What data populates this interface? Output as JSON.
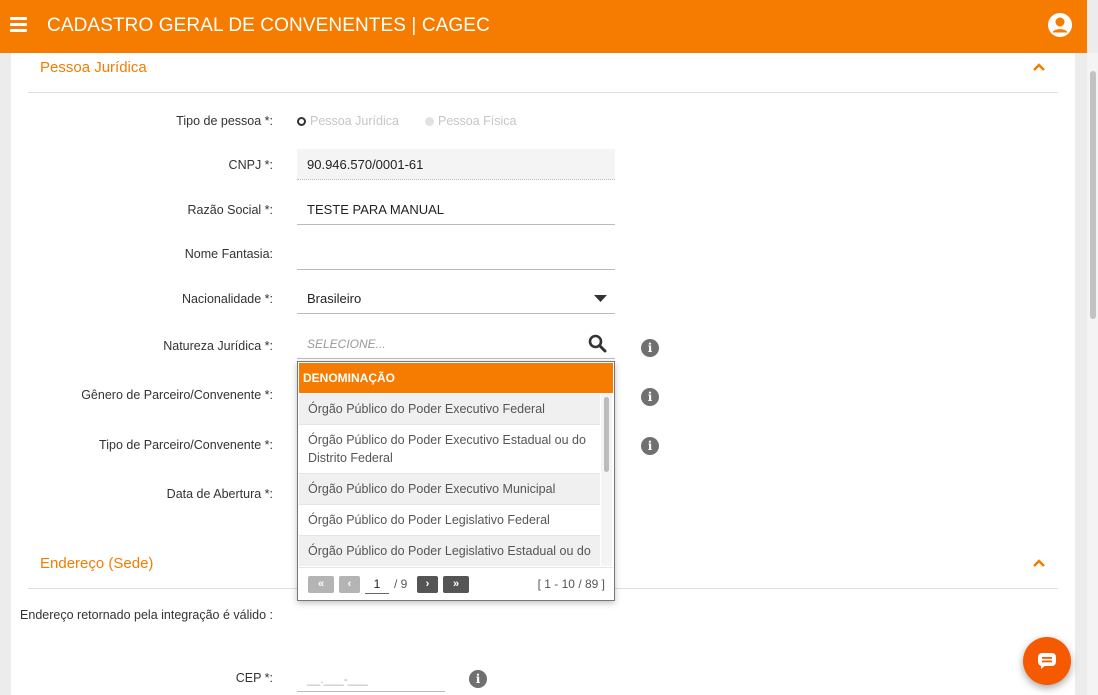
{
  "app": {
    "title": "CADASTRO GERAL DE CONVENENTES | CAGEC"
  },
  "icons": {
    "menu": "hamburger-icon",
    "user": "user-circle-icon",
    "collapse": "chevron-up-icon",
    "search": "search-icon",
    "info": "info-icon",
    "chat": "chat-icon"
  },
  "colors": {
    "accent": "#f57c00",
    "chat": "#f55a00"
  },
  "pessoa_juridica": {
    "section_title": "Pessoa Jurídica",
    "tipo_pessoa": {
      "label": "Tipo de pessoa *:",
      "options": [
        "Pessoa Jurídica",
        "Pessoa Física"
      ],
      "selected": "Pessoa Jurídica"
    },
    "cnpj": {
      "label": "CNPJ *:",
      "value": "90.946.570/0001-61"
    },
    "razao_social": {
      "label": "Razão Social *:",
      "value": "TESTE PARA MANUAL"
    },
    "nome_fantasia": {
      "label": "Nome Fantasia:",
      "value": ""
    },
    "nacionalidade": {
      "label": "Nacionalidade *:",
      "value": "Brasileiro"
    },
    "natureza_juridica": {
      "label": "Natureza Jurídica *:",
      "placeholder": "SELECIONE...",
      "dropdown": {
        "header": "DENOMINAÇÃO",
        "items": [
          "Órgão Público do Poder Executivo Federal",
          "Órgão Público do Poder Executivo Estadual ou do Distrito Federal",
          "Órgão Público do Poder Executivo Municipal",
          "Órgão Público do Poder Legislativo Federal",
          "Órgão Público do Poder Legislativo Estadual ou do"
        ],
        "pager": {
          "first": "«",
          "prev": "‹",
          "next": "›",
          "last": "»",
          "page": "1",
          "total": "/ 9",
          "range": "[ 1 - 10 / 89 ]"
        }
      }
    },
    "genero": {
      "label": "Gênero de Parceiro/Convenente *:"
    },
    "tipo_parceiro": {
      "label": "Tipo de Parceiro/Convenente *:"
    },
    "data_abertura": {
      "label": "Data de Abertura *:"
    }
  },
  "endereco": {
    "section_title": "Endereço (Sede)",
    "integracao": {
      "label": "Endereço retornado pela integração é válido :"
    },
    "cep": {
      "label": "CEP *:",
      "placeholder": "__.___-___"
    }
  }
}
